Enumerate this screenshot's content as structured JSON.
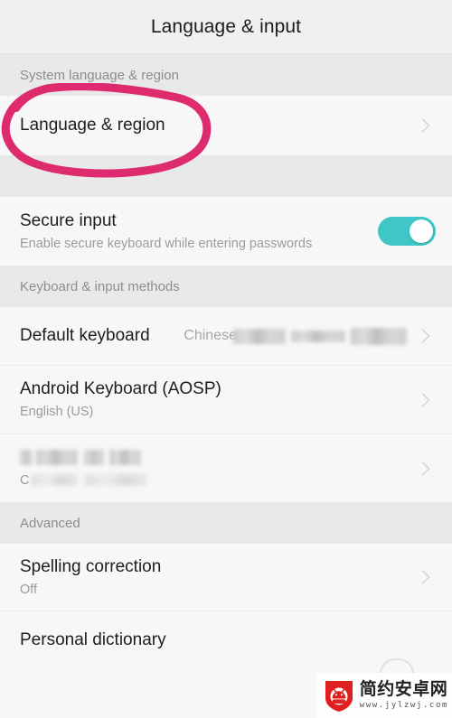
{
  "header": {
    "title": "Language & input"
  },
  "sections": [
    {
      "id": "system-language-region",
      "label": "System language & region",
      "rows": [
        {
          "id": "language-and-region",
          "title": "Language & region",
          "subtitle": "",
          "value": "",
          "control": "chevron",
          "annotated": true
        }
      ]
    },
    {
      "id": "secure-input-group",
      "label": "",
      "rows": [
        {
          "id": "secure-input",
          "title": "Secure input",
          "subtitle": "Enable secure keyboard while entering passwords",
          "value": "",
          "control": "switch",
          "switch_on": true
        }
      ]
    },
    {
      "id": "keyboard-input-methods",
      "label": "Keyboard & input methods",
      "rows": [
        {
          "id": "default-keyboard",
          "title": "Default keyboard",
          "subtitle": "",
          "value": "Chinese",
          "value_redacted": true,
          "control": "chevron"
        },
        {
          "id": "android-keyboard-aosp",
          "title": "Android Keyboard (AOSP)",
          "subtitle": "English (US)",
          "value": "",
          "control": "chevron"
        },
        {
          "id": "redacted-input-method",
          "title": "",
          "title_redacted": true,
          "subtitle": "C",
          "subtitle_redacted": true,
          "value": "",
          "control": "chevron"
        }
      ]
    },
    {
      "id": "advanced",
      "label": "Advanced",
      "rows": [
        {
          "id": "spelling-correction",
          "title": "Spelling correction",
          "subtitle": "Off",
          "value": "",
          "control": "chevron"
        },
        {
          "id": "personal-dictionary",
          "title": "Personal dictionary",
          "subtitle": "",
          "value": "",
          "control": "none"
        }
      ]
    }
  ],
  "annotation": {
    "shape": "hand-drawn-ellipse",
    "color": "#de2b6d",
    "target": "Language & region"
  },
  "watermark": {
    "site_name": "简约安卓网",
    "url": "www.jylzwj.com",
    "logo_color": "#e02020"
  },
  "colors": {
    "page_background": "#f7f7f7",
    "section_band": "#e9e9e9",
    "appbar_background": "#f0f0f0",
    "switch_on": "#3fc6c6",
    "title_text": "#1e1e1e",
    "secondary_text": "#9b9b9b",
    "annotation_pink": "#de2b6d"
  }
}
